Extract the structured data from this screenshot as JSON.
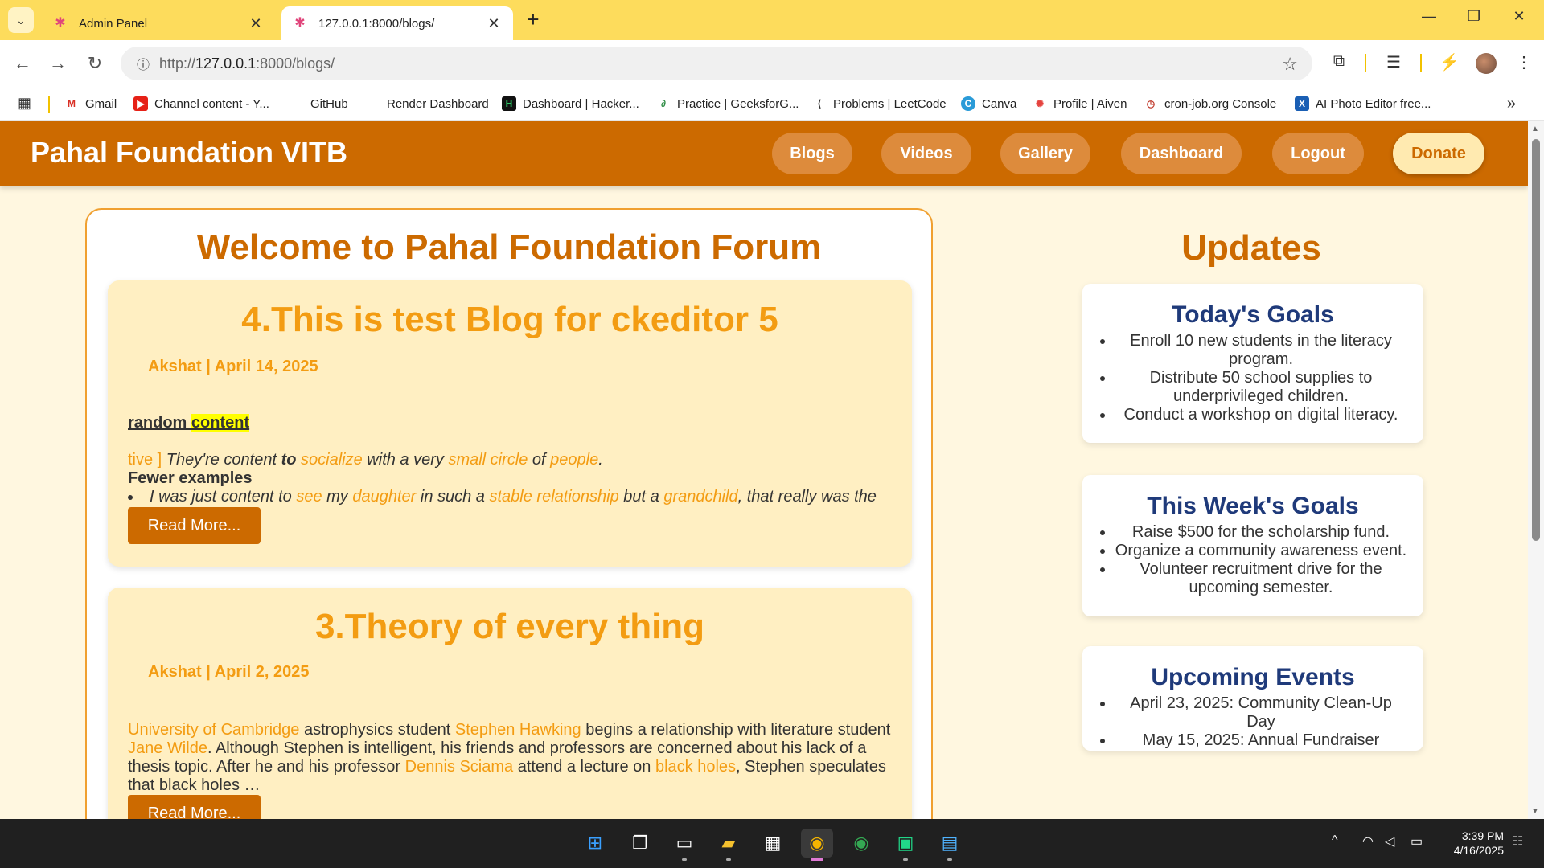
{
  "browser": {
    "tabs": [
      {
        "title": "Admin Panel",
        "active": false
      },
      {
        "title": "127.0.0.1:8000/blogs/",
        "active": true
      }
    ],
    "url": "http://127.0.0.1:8000/blogs/",
    "url_prefix": "http://",
    "url_host": "127.0.0.1",
    "url_rest": ":8000/blogs/",
    "bookmarks": [
      "Gmail",
      "Channel content - Y...",
      "GitHub",
      "Render Dashboard",
      "Dashboard | Hacker...",
      "Practice | GeeksforG...",
      "Problems | LeetCode",
      "Canva",
      "Profile | Aiven",
      "cron-job.org Console",
      "AI Photo Editor free..."
    ]
  },
  "site": {
    "brand": "Pahal Foundation VITB",
    "nav": [
      "Blogs",
      "Videos",
      "Gallery",
      "Dashboard",
      "Logout",
      "Donate"
    ]
  },
  "forum": {
    "title": "Welcome to Pahal Foundation Forum",
    "posts": [
      {
        "title": "4.This is test Blog for ckeditor 5",
        "meta": "Akshat | April 14, 2025",
        "heading_a": "random ",
        "heading_b": "content",
        "line1": {
          "a": "tive ]",
          "b": " They're content ",
          "c": "to",
          "d": " socialize",
          "e": " with a very ",
          "f": "small circle",
          "g": " of ",
          "h": "people",
          "i": "."
        },
        "fewer": "Fewer examples",
        "bullet": {
          "a": "I was just content to ",
          "b": "see",
          "c": " my ",
          "d": "daughter",
          "e": " in such a ",
          "f": "stable relationship",
          "g": " but a ",
          "h": "grandchild",
          "i": ", that really was the"
        },
        "read_more": "Read More..."
      },
      {
        "title": "3.Theory of every thing",
        "meta": "Akshat | April 2, 2025",
        "body": {
          "a": "University of Cambridge",
          "b": " astrophysics student ",
          "c": "Stephen Hawking",
          "d": " begins a relationship with literature student ",
          "e": "Jane Wilde",
          "f": ". Although Stephen is intelligent, his friends and professors are concerned about his lack of a thesis topic. After he and his professor ",
          "g": "Dennis Sciama",
          "h": " attend a lecture on ",
          "i": "black holes",
          "j": ", Stephen speculates that black holes …"
        },
        "read_more": "Read More..."
      }
    ]
  },
  "updates": {
    "title": "Updates",
    "cards": [
      {
        "title": "Today's Goals",
        "items": [
          "Enroll 10 new students in the literacy program.",
          "Distribute 50 school supplies to underprivileged children.",
          "Conduct a workshop on digital literacy."
        ]
      },
      {
        "title": "This Week's Goals",
        "items": [
          "Raise $500 for the scholarship fund.",
          "Organize a community awareness event.",
          "Volunteer recruitment drive for the upcoming semester."
        ]
      },
      {
        "title": "Upcoming Events",
        "items": [
          "April 23, 2025: Community Clean-Up Day",
          "May 15, 2025: Annual Fundraiser"
        ]
      }
    ]
  },
  "taskbar": {
    "time": "3:39 PM",
    "date": "4/16/2025"
  }
}
